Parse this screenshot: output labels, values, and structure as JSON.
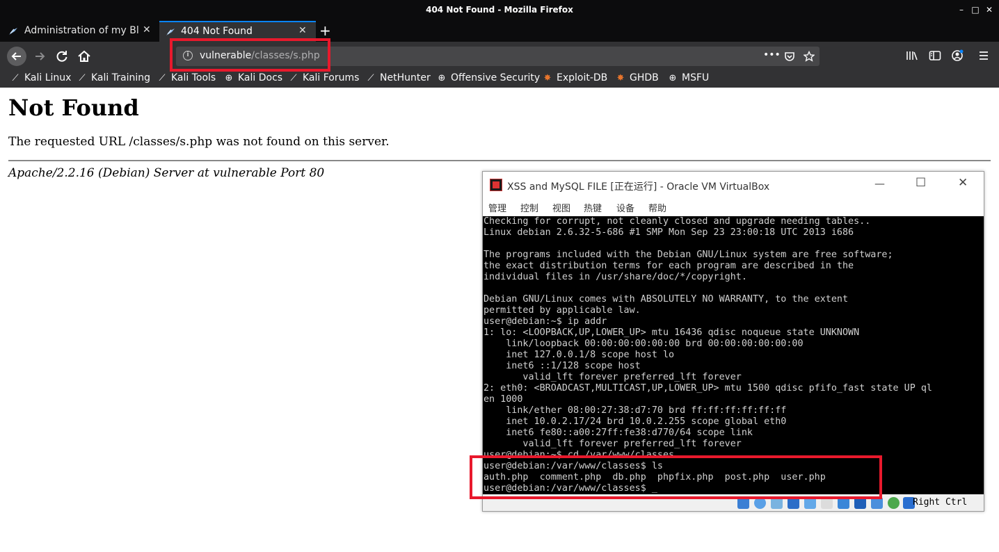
{
  "window": {
    "title": "404 Not Found - Mozilla Firefox",
    "controls": [
      "–",
      "□",
      "✕"
    ]
  },
  "tabs": [
    {
      "label": "Administration of my Blog",
      "active": false
    },
    {
      "label": "404 Not Found",
      "active": true
    }
  ],
  "newtab_label": "+",
  "navbar": {
    "url_host": "vulnerable",
    "url_path": "/classes/s.php"
  },
  "bookmarks": [
    {
      "label": "Kali Linux",
      "icon": "kali-icon"
    },
    {
      "label": "Kali Training",
      "icon": "kali-icon"
    },
    {
      "label": "Kali Tools",
      "icon": "kali-icon"
    },
    {
      "label": "Kali Docs",
      "icon": "globe-icon"
    },
    {
      "label": "Kali Forums",
      "icon": "kali-icon"
    },
    {
      "label": "NetHunter",
      "icon": "kali-icon"
    },
    {
      "label": "Offensive Security",
      "icon": "globe-icon"
    },
    {
      "label": "Exploit-DB",
      "icon": "exploitdb-icon"
    },
    {
      "label": "GHDB",
      "icon": "exploitdb-icon"
    },
    {
      "label": "MSFU",
      "icon": "globe-icon"
    }
  ],
  "page": {
    "heading": "Not Found",
    "message": "The requested URL /classes/s.php was not found on this server.",
    "address": "Apache/2.2.16 (Debian) Server at vulnerable Port 80"
  },
  "vbox": {
    "title": "XSS and MySQL FILE [正在运行] - Oracle VM VirtualBox",
    "menu": [
      "管理",
      "控制",
      "视图",
      "热键",
      "设备",
      "帮助"
    ],
    "host_key": "Right Ctrl",
    "terminal": [
      "Checking for corrupt, not cleanly closed and upgrade needing tables..",
      "Linux debian 2.6.32-5-686 #1 SMP Mon Sep 23 23:00:18 UTC 2013 i686",
      "",
      "The programs included with the Debian GNU/Linux system are free software;",
      "the exact distribution terms for each program are described in the",
      "individual files in /usr/share/doc/*/copyright.",
      "",
      "Debian GNU/Linux comes with ABSOLUTELY NO WARRANTY, to the extent",
      "permitted by applicable law.",
      "user@debian:~$ ip addr",
      "1: lo: <LOOPBACK,UP,LOWER_UP> mtu 16436 qdisc noqueue state UNKNOWN",
      "    link/loopback 00:00:00:00:00:00 brd 00:00:00:00:00:00",
      "    inet 127.0.0.1/8 scope host lo",
      "    inet6 ::1/128 scope host",
      "       valid_lft forever preferred_lft forever",
      "2: eth0: <BROADCAST,MULTICAST,UP,LOWER_UP> mtu 1500 qdisc pfifo_fast state UP ql",
      "en 1000",
      "    link/ether 08:00:27:38:d7:70 brd ff:ff:ff:ff:ff:ff",
      "    inet 10.0.2.17/24 brd 10.0.2.255 scope global eth0",
      "    inet6 fe80::a00:27ff:fe38:d770/64 scope link",
      "       valid_lft forever preferred_lft forever",
      "user@debian:~$ cd /var/www/classes",
      "user@debian:/var/www/classes$ ls",
      "auth.php  comment.php  db.php  phpfix.php  post.php  user.php",
      "user@debian:/var/www/classes$ _"
    ]
  },
  "colors": {
    "highlight": "#e8192c",
    "accent": "#0a84ff"
  }
}
